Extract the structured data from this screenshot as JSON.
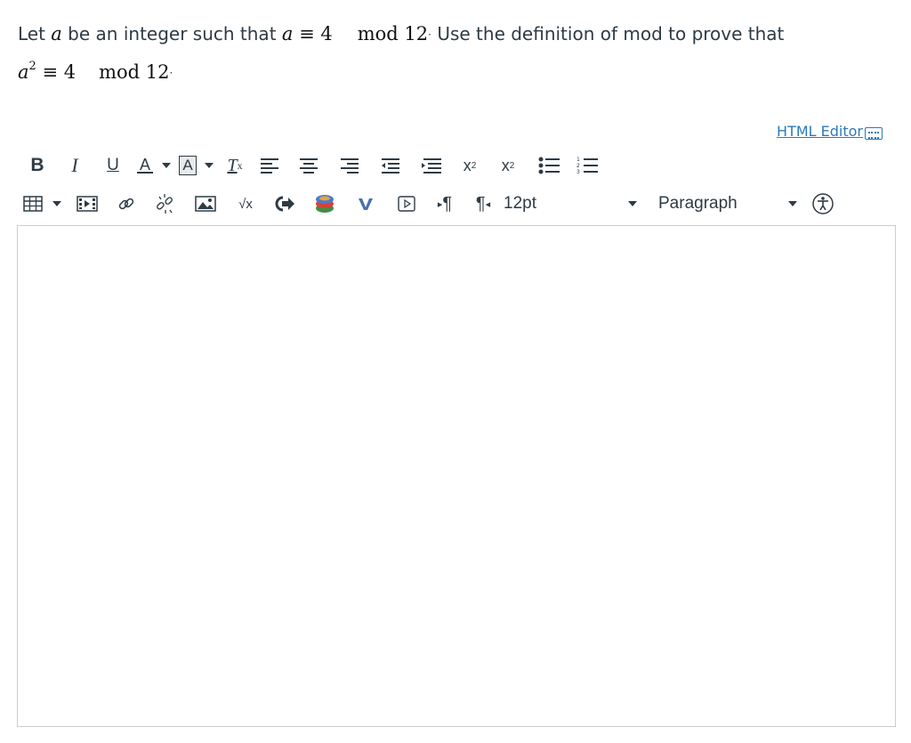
{
  "question": {
    "line1_prefix": "Let ",
    "line1_var": "a",
    "line1_middle": " be an integer such that ",
    "line1_congruence": "a ≡ 4",
    "line1_mod": "mod 12",
    "line1_suffix": " Use the definition of mod to prove that",
    "line2_congruence_base": "a",
    "line2_exp": "2",
    "line2_equiv": " ≡ 4",
    "line2_mod": "mod 12"
  },
  "editor": {
    "html_editor_link": "HTML Editor",
    "font_size_value": "12pt",
    "block_format_value": "Paragraph",
    "content": ""
  },
  "toolbar_row1": [
    "bold-icon",
    "italic-icon",
    "underline-icon",
    "text-color-icon",
    "background-color-icon",
    "clear-formatting-icon",
    "align-left-icon",
    "align-center-icon",
    "align-right-icon",
    "outdent-icon",
    "indent-icon",
    "superscript-icon",
    "subscript-icon",
    "bullet-list-icon",
    "numbered-list-icon"
  ],
  "toolbar_row2": [
    "table-icon",
    "media-icon",
    "link-icon",
    "unlink-icon",
    "image-icon",
    "math-equation-icon",
    "embed-icon",
    "apps-icon",
    "vimeo-icon",
    "video-icon",
    "ltr-icon",
    "rtl-icon",
    "font-size-select",
    "block-format-select",
    "accessibility-icon"
  ],
  "colors": {
    "text": "#2d3b45",
    "link": "#2b7abc",
    "border": "#c7cdd1"
  }
}
